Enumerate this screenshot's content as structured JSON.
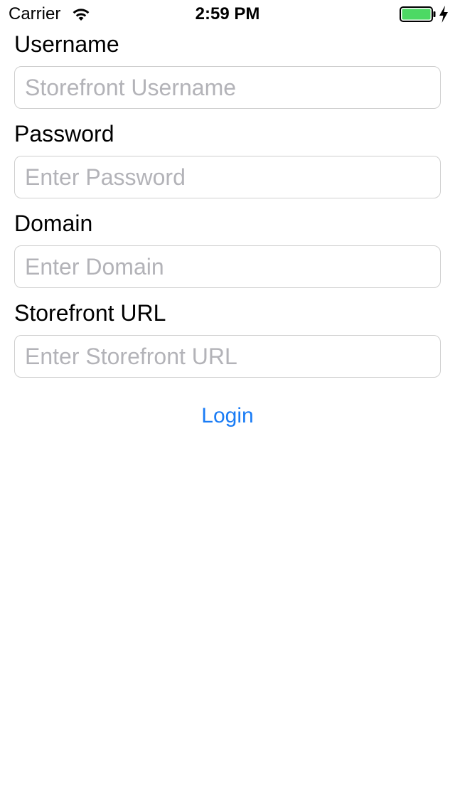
{
  "status_bar": {
    "carrier": "Carrier",
    "time": "2:59 PM",
    "wifi_icon": "wifi-icon",
    "battery_icon": "battery-icon",
    "charging_icon": "bolt-icon",
    "battery_color": "#4cd964"
  },
  "form": {
    "fields": [
      {
        "label": "Username",
        "placeholder": "Storefront Username",
        "value": ""
      },
      {
        "label": "Password",
        "placeholder": "Enter Password",
        "value": ""
      },
      {
        "label": "Domain",
        "placeholder": "Enter Domain",
        "value": ""
      },
      {
        "label": "Storefront URL",
        "placeholder": "Enter Storefront URL",
        "value": ""
      }
    ],
    "login_label": "Login",
    "accent_color": "#1a7cf5"
  }
}
